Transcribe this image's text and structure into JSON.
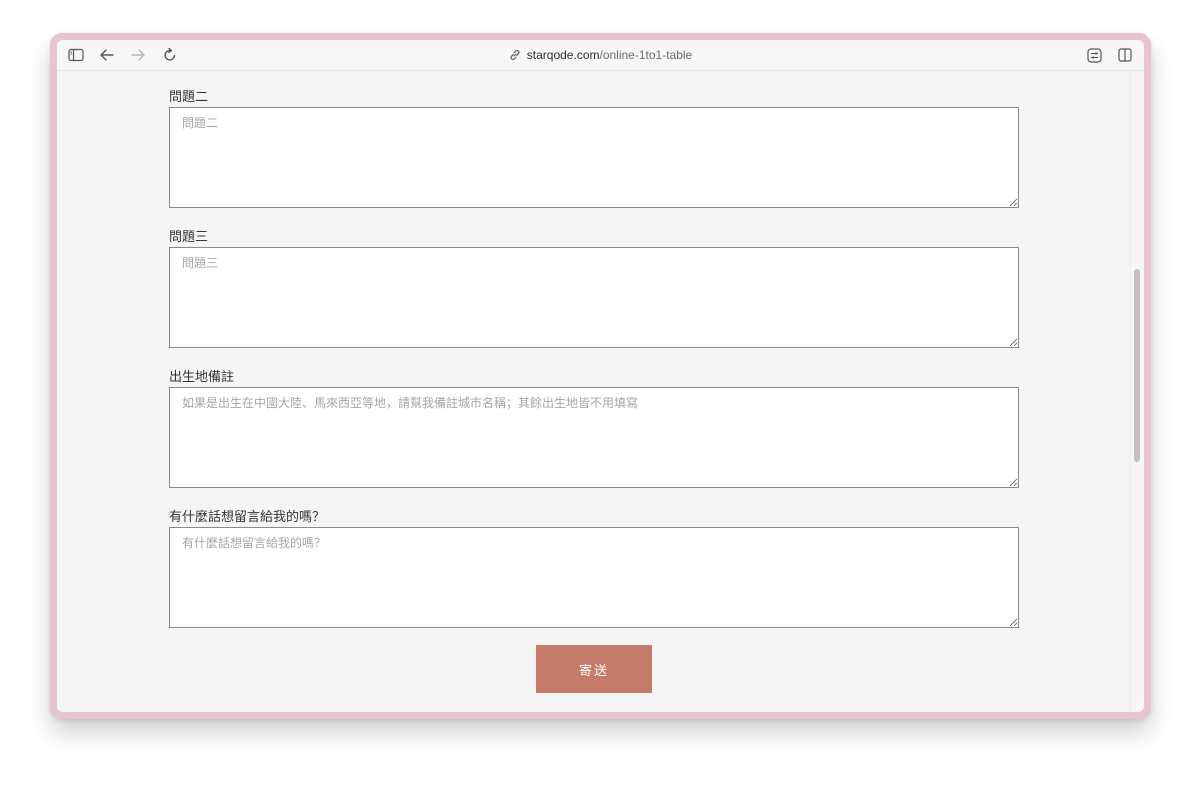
{
  "browser": {
    "url_domain": "starqode.com",
    "url_path": "/online-1to1-table",
    "icons": {
      "sidebar": "sidebar-icon",
      "back": "arrow-left-icon",
      "forward": "arrow-right-icon",
      "reload": "reload-icon",
      "link": "link-icon",
      "reader": "reader-icon",
      "split": "split-view-icon"
    }
  },
  "form": {
    "fields": [
      {
        "label": "問題二",
        "placeholder": "問題二",
        "value": ""
      },
      {
        "label": "問題三",
        "placeholder": "問題三",
        "value": ""
      },
      {
        "label": "出生地備註",
        "placeholder": "如果是出生在中國大陸、馬來西亞等地，請幫我備註城市名稱；其餘出生地皆不用填寫",
        "value": ""
      },
      {
        "label": "有什麼話想留言給我的嗎？",
        "placeholder": "有什麼話想留言給我的嗎？",
        "value": ""
      }
    ],
    "submit_label": "寄送"
  },
  "colors": {
    "window_frame": "#e8c4d0",
    "submit_button": "#c47b6a",
    "page_background": "#f5f5f5"
  }
}
